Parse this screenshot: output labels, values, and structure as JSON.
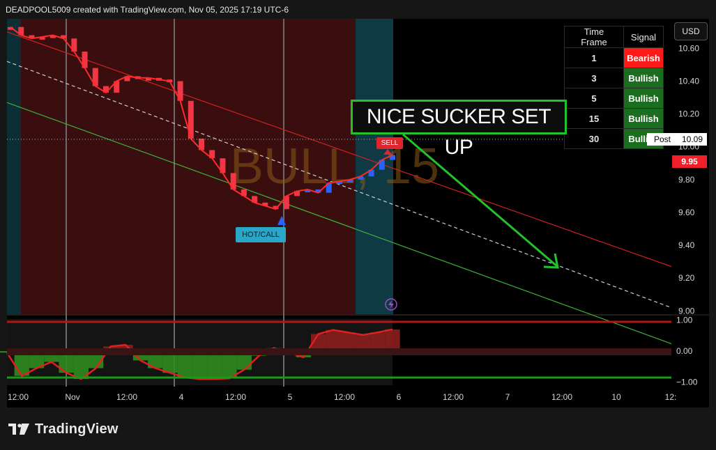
{
  "header": {
    "text": "DEADPOOL5009 created with TradingView.com, Nov 05, 2025 17:19 UTC-6"
  },
  "footer": {
    "brand": "TradingView"
  },
  "currency_button": "USD",
  "watermark": "BULL, 15",
  "annotation_text": "NICE SUCKER SET UP",
  "signals_table": {
    "headers": [
      "Time Frame",
      "Signal"
    ],
    "rows": [
      {
        "tf": "1",
        "signal": "Bearish"
      },
      {
        "tf": "3",
        "signal": "Bullish"
      },
      {
        "tf": "5",
        "signal": "Bullish"
      },
      {
        "tf": "15",
        "signal": "Bullish"
      },
      {
        "tf": "30",
        "signal": "Bullish"
      }
    ]
  },
  "labels": {
    "sell": "SELL",
    "hot_call": "HOT/CALL",
    "post": "Post",
    "post_price": "10.09",
    "last_price": "9.95"
  },
  "colors": {
    "bullish": "#1b6e20",
    "bearish": "#ff1a1a",
    "candle_down": "#f23645",
    "candle_up": "#2962ff",
    "annotation_border": "#22c22a"
  },
  "chart_data": {
    "type": "line",
    "price_axis": {
      "ticks": [
        "10.60",
        "10.40",
        "10.20",
        "10.00",
        "9.80",
        "9.60",
        "9.40",
        "9.20",
        "9.00"
      ],
      "ylim": [
        8.98,
        10.78
      ]
    },
    "oscillator_axis": {
      "ticks": [
        "1.00",
        "0.00",
        "−1.00"
      ],
      "ylim": [
        -1.1,
        1.1
      ]
    },
    "time_axis": {
      "ticks": [
        "12:00",
        "Nov",
        "12:00",
        "4",
        "12:00",
        "5",
        "12:00",
        "6",
        "12:00",
        "7",
        "12:00",
        "10",
        "12:"
      ]
    },
    "series": [
      {
        "values": [
          10.73,
          10.68,
          10.66,
          10.67,
          10.68,
          10.66,
          10.58,
          10.48,
          10.37,
          10.33,
          10.4,
          10.43,
          10.42,
          10.42,
          10.41,
          10.4,
          10.28,
          10.05,
          9.98,
          9.93,
          9.84,
          9.74,
          9.7,
          9.66,
          9.64,
          9.62,
          9.7,
          9.73,
          9.74,
          9.72,
          9.78,
          9.79,
          9.8,
          9.82,
          9.86,
          9.92,
          9.95
        ]
      }
    ],
    "trendlines": [
      {
        "name": "upper",
        "start": 10.7,
        "end": 9.27
      },
      {
        "name": "mid",
        "start": 10.52,
        "end": 9.02
      },
      {
        "name": "lower",
        "start": 10.27,
        "end": 8.8
      }
    ],
    "oscillator": [
      -0.05,
      -0.8,
      -0.55,
      -0.35,
      -0.7,
      -0.9,
      -0.55,
      0.15,
      0.2,
      -0.3,
      -0.55,
      -0.7,
      -0.85,
      -0.9,
      -0.9,
      -0.88,
      -0.6,
      -0.15,
      0.1,
      -0.05,
      -0.2,
      0.55,
      0.68,
      0.6,
      0.52,
      0.6,
      0.7
    ]
  }
}
